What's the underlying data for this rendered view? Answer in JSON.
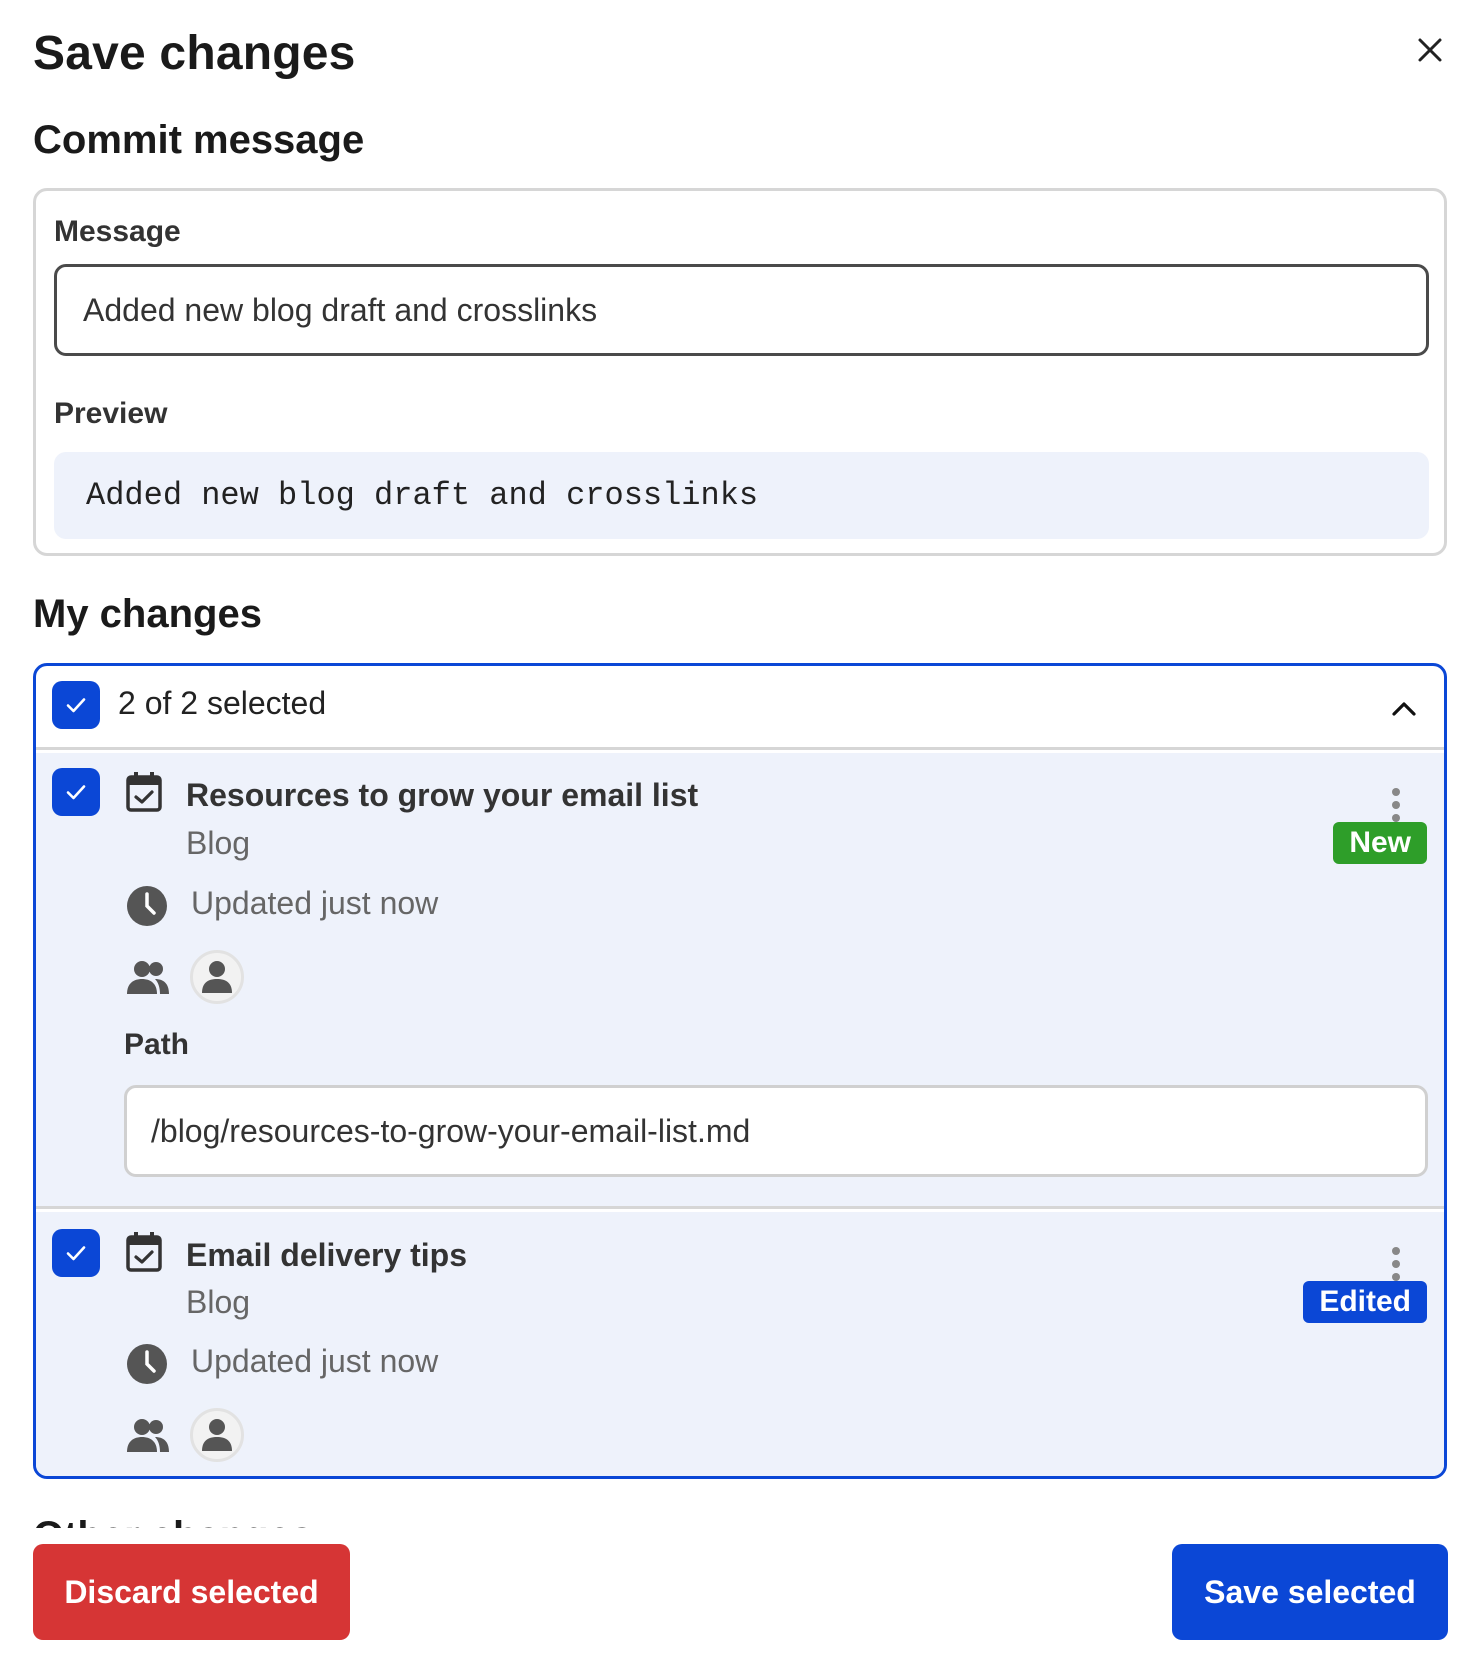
{
  "dialog": {
    "title": "Save changes"
  },
  "commit": {
    "heading": "Commit message",
    "message_label": "Message",
    "message_value": "Added new blog draft and crosslinks",
    "preview_label": "Preview",
    "preview_text": "Added new blog draft and crosslinks"
  },
  "changes": {
    "heading": "My changes",
    "selection_text": "2 of 2 selected",
    "items": [
      {
        "title": "Resources to grow your email list",
        "collection": "Blog",
        "badge": "New",
        "updated": "Updated just now",
        "path_label": "Path",
        "path_value": "/blog/resources-to-grow-your-email-list.md"
      },
      {
        "title": "Email delivery tips",
        "collection": "Blog",
        "badge": "Edited",
        "updated": "Updated just now"
      }
    ]
  },
  "other": {
    "heading": "Other changes"
  },
  "footer": {
    "discard_label": "Discard selected",
    "save_label": "Save selected"
  },
  "colors": {
    "primary": "#0b47d6",
    "danger": "#d63535",
    "success": "#2e9e29",
    "item_bg": "#eef2fb"
  }
}
